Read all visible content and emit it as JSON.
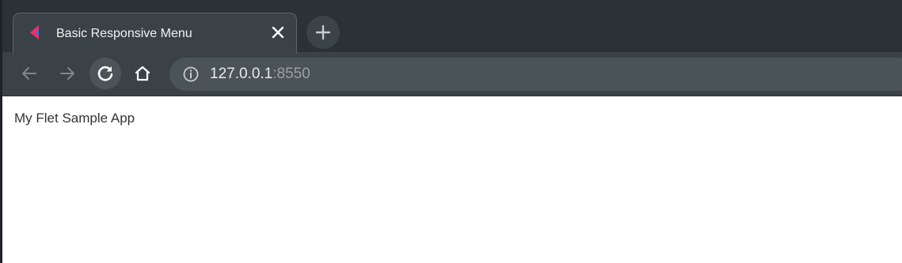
{
  "tab": {
    "title": "Basic Responsive Menu",
    "favicon": "flet-logo-icon",
    "close": "close-icon"
  },
  "new_tab": {
    "icon": "plus-icon"
  },
  "toolbar": {
    "back_icon": "arrow-left-icon",
    "forward_icon": "arrow-right-icon",
    "reload_icon": "reload-icon",
    "home_icon": "home-icon"
  },
  "omnibox": {
    "info_icon": "info-icon",
    "url_host": "127.0.0.1",
    "url_port": ":8550"
  },
  "page": {
    "app_title": "My Flet Sample App"
  },
  "colors": {
    "titlebar": "#2a3137",
    "toolbar": "#3a4247",
    "omnibox": "#4a5358",
    "favicon_pink": "#e8306f",
    "favicon_blue": "#4f6dd8"
  }
}
